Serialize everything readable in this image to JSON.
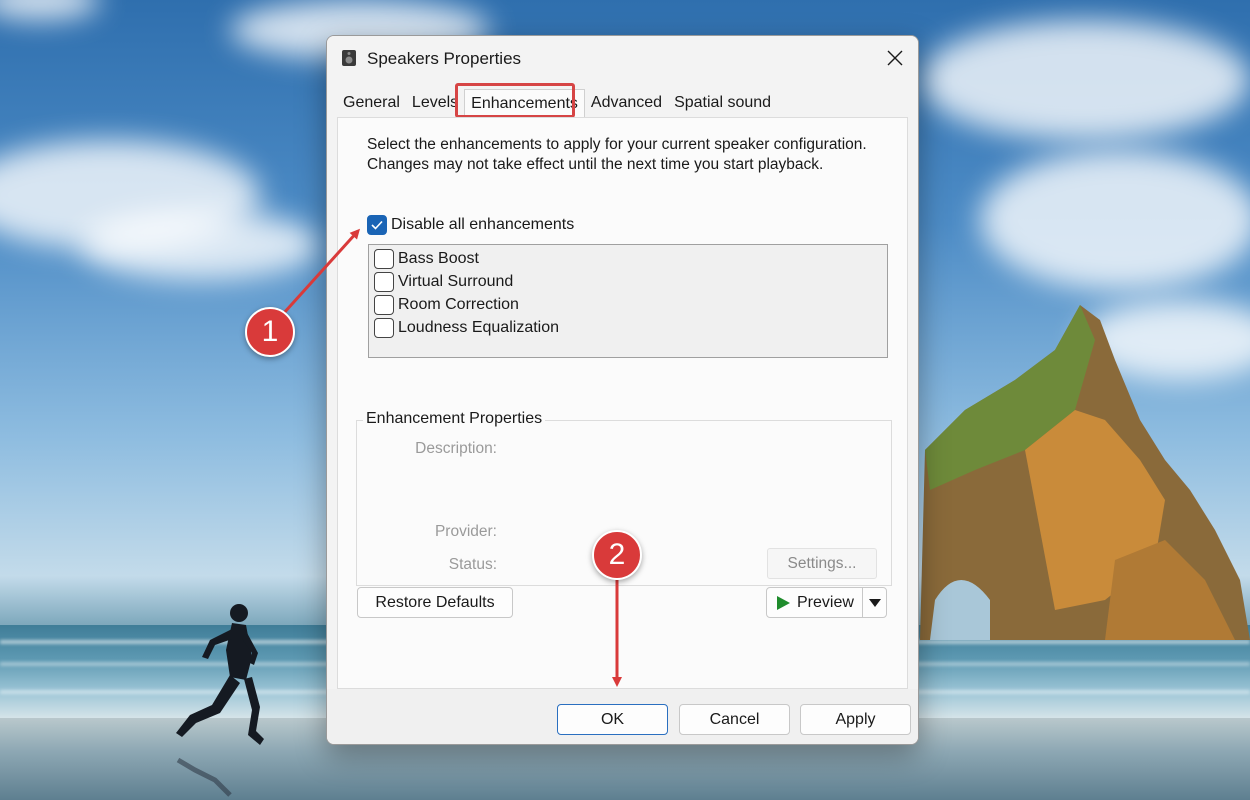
{
  "dialog": {
    "title": "Speakers Properties",
    "close_glyph": "✕",
    "tabs": [
      "General",
      "Levels",
      "Enhancements",
      "Advanced",
      "Spatial sound"
    ],
    "active_tab": "Enhancements",
    "intro_text": "Select the enhancements to apply for your current speaker configuration. Changes may not take effect until the next time you start playback.",
    "master_checkbox": {
      "label": "Disable all enhancements",
      "checked": true
    },
    "enhancements": [
      {
        "label": "Bass Boost",
        "checked": false
      },
      {
        "label": "Virtual Surround",
        "checked": false
      },
      {
        "label": "Room Correction",
        "checked": false
      },
      {
        "label": "Loudness Equalization",
        "checked": false
      }
    ],
    "properties_group": {
      "title": "Enhancement Properties",
      "description_label": "Description:",
      "provider_label": "Provider:",
      "status_label": "Status:",
      "settings_button": "Settings..."
    },
    "restore_defaults": "Restore Defaults",
    "preview_button": "Preview",
    "footer": {
      "ok": "OK",
      "cancel": "Cancel",
      "apply": "Apply"
    }
  },
  "annotations": {
    "step1": "1",
    "step2": "2",
    "color": "#d93a3a"
  },
  "colors": {
    "accent": "#1a64b5",
    "highlight": "#d64545"
  }
}
